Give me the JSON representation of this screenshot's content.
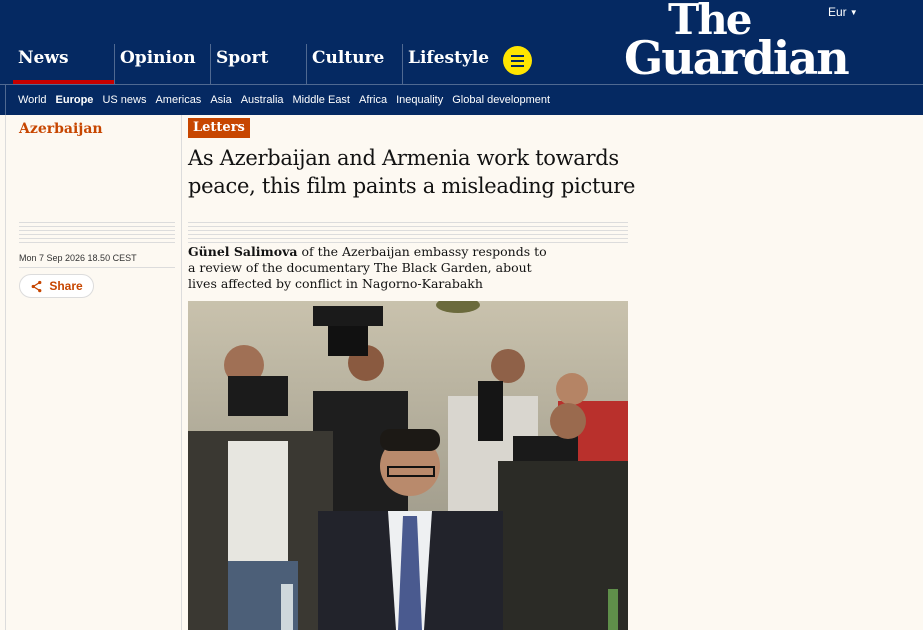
{
  "header": {
    "edition": "Eur",
    "logo_line1": "The",
    "logo_line2": "Guardian",
    "pillars": [
      "News",
      "Opinion",
      "Sport",
      "Culture",
      "Lifestyle"
    ],
    "active_pillar": "News"
  },
  "subnav": {
    "items": [
      "World",
      "Europe",
      "US news",
      "Americas",
      "Asia",
      "Australia",
      "Middle East",
      "Africa",
      "Inequality",
      "Global development"
    ],
    "current": "Europe"
  },
  "article": {
    "section": "Azerbaijan",
    "kicker": "Letters",
    "headline": "As Azerbaijan and Armenia work towards peace, this film paints a misleading picture",
    "byline": "Günel Salimova",
    "standfirst": " of the Azerbaijan embassy responds to a review of the documentary The Black Garden, about lives affected by conflict in Nagorno-Karabakh",
    "dateline": "Mon 7 Sep 2026 18.50 CEST",
    "share_label": "Share"
  },
  "colors": {
    "brand_navy": "#052962",
    "news_red": "#c70000",
    "opinion_orange": "#c74600",
    "menu_yellow": "#ffe500",
    "page_bg": "#fdf9f2"
  }
}
